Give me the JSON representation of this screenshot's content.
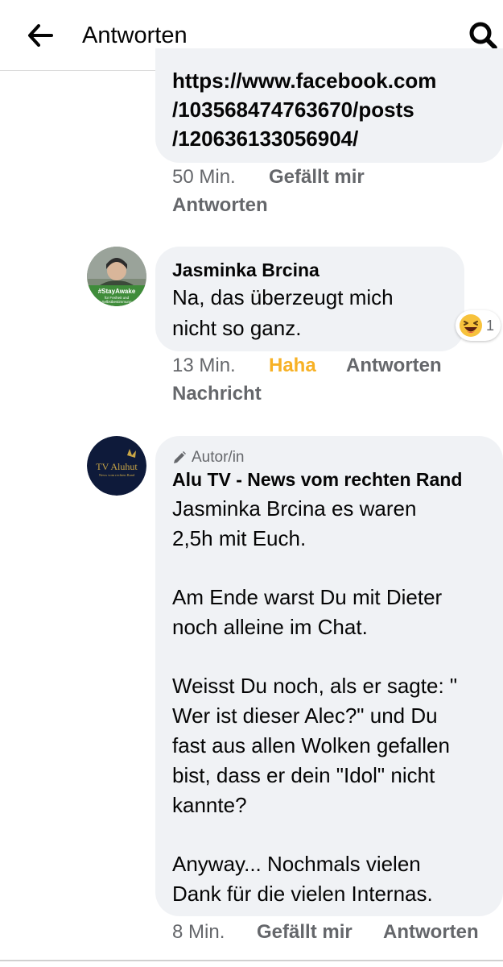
{
  "header": {
    "title": "Antworten",
    "back_icon": "arrow-left-icon",
    "search_icon": "search-icon"
  },
  "comment1": {
    "url_lines": [
      "https://www.facebook.com",
      "/103568474763670/posts",
      "/120636133056904/"
    ],
    "time": "50 Min.",
    "like_label": "Gefällt mir",
    "reply_label": "Antworten"
  },
  "comment2": {
    "author": "Jasminka Brcina",
    "avatar_text": [
      "#StayAwake",
      "für Freiheit und",
      "Selbstbestimmung"
    ],
    "text_lines": [
      "Na, das überzeugt mich",
      "nicht so ganz."
    ],
    "reaction": {
      "icon": "haha-emoji-icon",
      "count": "1"
    },
    "time": "13 Min.",
    "haha_label": "Haha",
    "reply_label": "Antworten",
    "message_label": "Nachricht"
  },
  "comment3": {
    "author_badge": "Autor/in",
    "author": "Alu TV - News vom rechten Rand",
    "avatar_text": [
      "TV Aluhut",
      "News vom rechten Rand"
    ],
    "text_lines": [
      "Jasminka Brcina es waren",
      "2,5h mit Euch.",
      "Am Ende warst Du mit Dieter",
      "noch alleine im Chat.",
      "Weisst Du noch, als er sagte: \"",
      "Wer ist dieser Alec?\" und Du",
      "fast aus allen Wolken gefallen",
      "bist, dass er dein \"Idol\" nicht",
      "kannte?",
      "Anyway... Nochmals vielen",
      "Dank für die vielen Internas."
    ],
    "time": "8 Min.",
    "like_label": "Gefällt mir",
    "reply_label": "Antworten"
  },
  "colors": {
    "bubble": "#f0f2f5",
    "meta_text": "#65676b",
    "haha": "#f7b125",
    "text": "#050505",
    "tv_avatar_bg": "#0e1a3a",
    "tv_avatar_gold": "#c9a646",
    "stayawake_green": "#3f8c3a"
  }
}
